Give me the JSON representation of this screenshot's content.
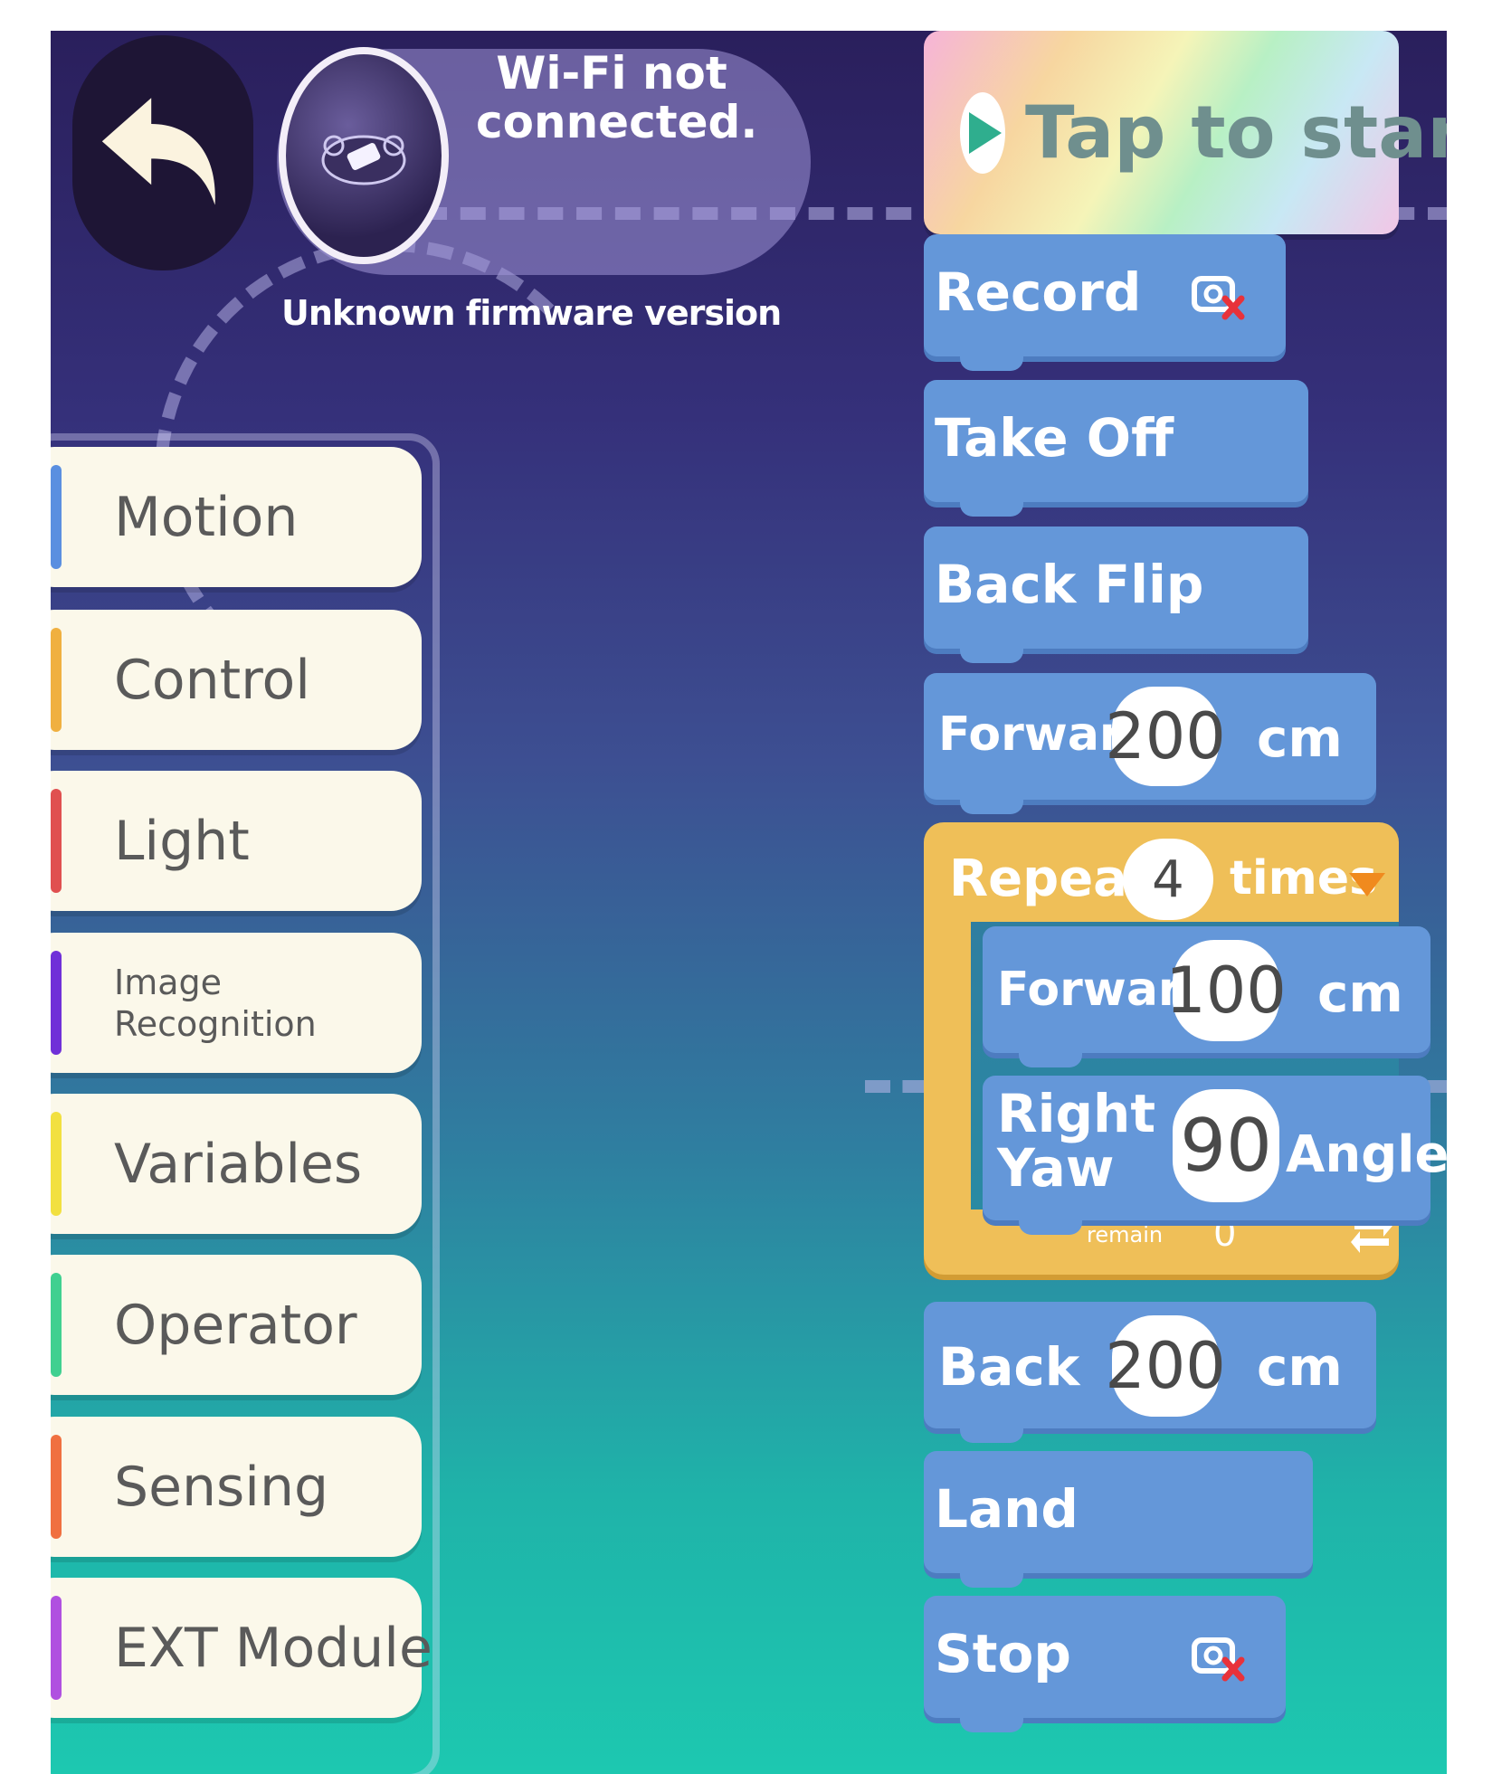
{
  "header": {
    "wifi_status": "Wi-Fi not connected.",
    "firmware": "Unknown firmware version",
    "start_label": "Tap to start"
  },
  "categories": [
    {
      "label": "Motion",
      "color": "#5a8fe0"
    },
    {
      "label": "Control",
      "color": "#f0b040"
    },
    {
      "label": "Light",
      "color": "#e05050"
    },
    {
      "label": "Image Recognition",
      "color": "#7030d8"
    },
    {
      "label": "Variables",
      "color": "#f2e040"
    },
    {
      "label": "Operator",
      "color": "#40d090"
    },
    {
      "label": "Sensing",
      "color": "#f07040"
    },
    {
      "label": "EXT Module",
      "color": "#b050e0"
    }
  ],
  "blocks": {
    "record": "Record",
    "take_off": "Take Off",
    "back_flip": "Back Flip",
    "forward1": {
      "label": "Forward",
      "value": "200",
      "unit": "cm"
    },
    "repeat": {
      "label": "Repeat",
      "value": "4",
      "unit": "times",
      "remain_label": "remain",
      "remain_value": "0"
    },
    "forward2": {
      "label": "Forward",
      "value": "100",
      "unit": "cm"
    },
    "right_yaw": {
      "label": "Right Yaw",
      "value": "90",
      "unit": "Angle"
    },
    "back": {
      "label": "Back",
      "value": "200",
      "unit": "cm"
    },
    "land": "Land",
    "stop": "Stop"
  },
  "colors": {
    "block_blue": "#6497d9",
    "repeat_orange": "#efbf58",
    "category_bg": "#fbf8ea"
  }
}
